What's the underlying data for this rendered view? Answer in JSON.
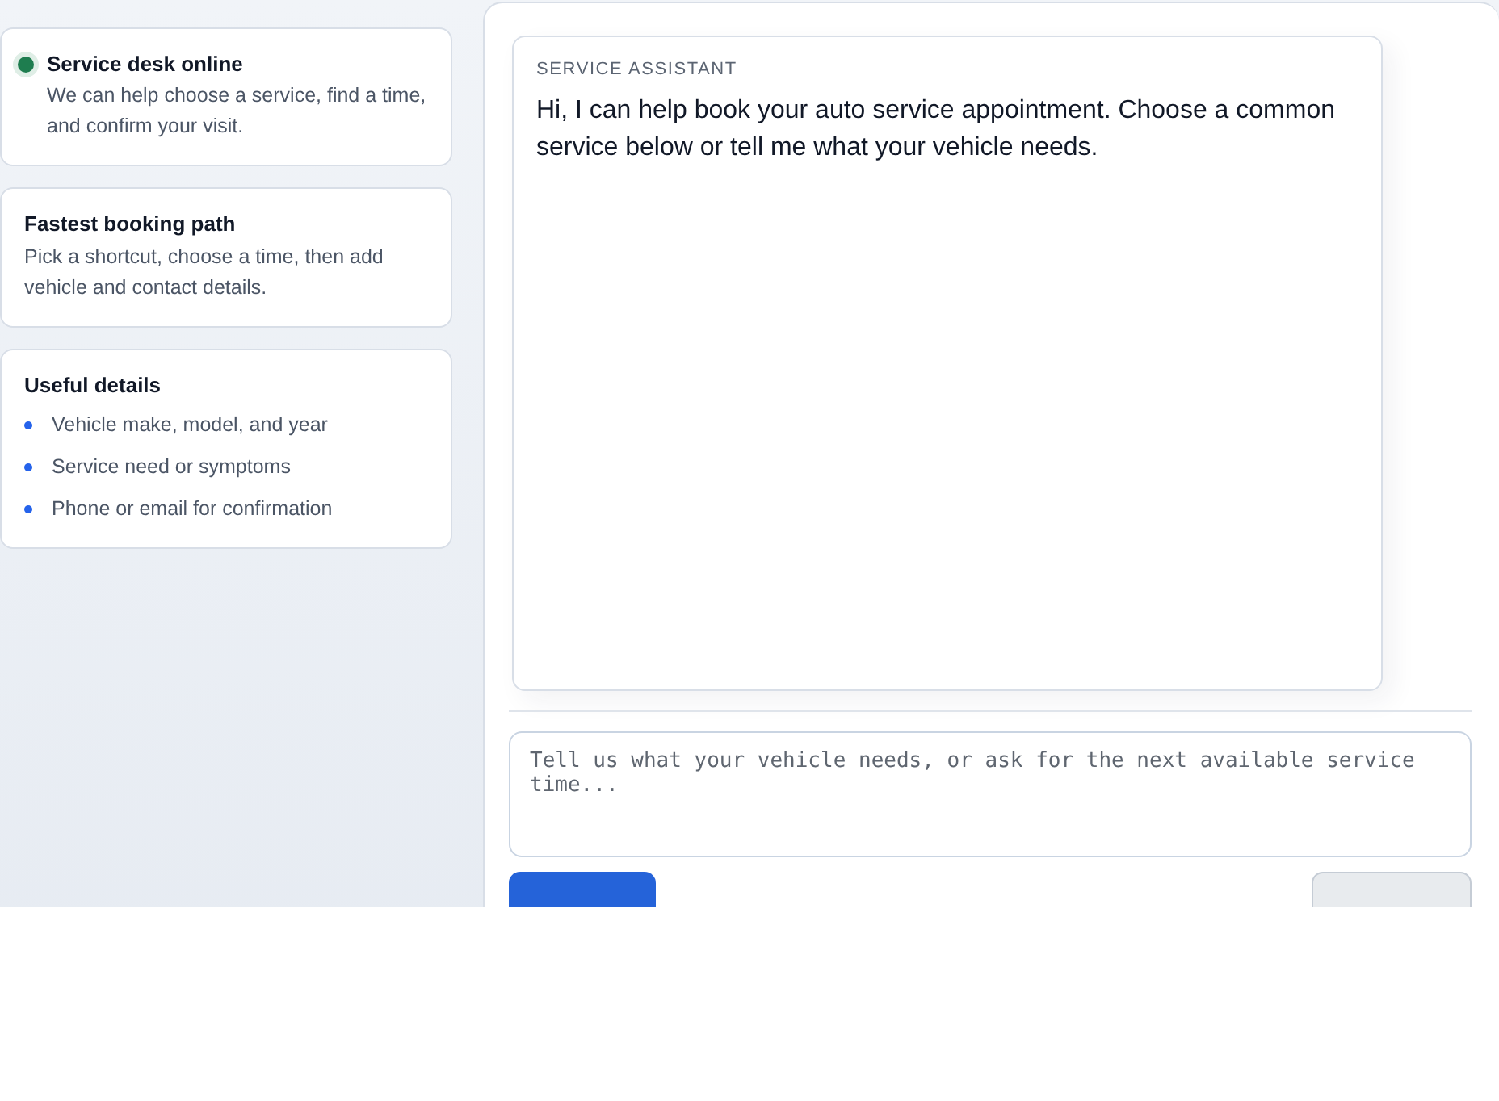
{
  "status": {
    "online": true,
    "title": "Service desk online",
    "text": "We can help choose a service, find a time, and confirm your visit."
  },
  "path_card": {
    "title": "Fastest booking path",
    "text": "Pick a shortcut, choose a time, then add vehicle and contact details."
  },
  "details_card": {
    "title": "Useful details",
    "items": [
      "Vehicle make, model, and year",
      "Service need or symptoms",
      "Phone or email for confirmation"
    ]
  },
  "message": {
    "sender": "SERVICE ASSISTANT",
    "text": "Hi, I can help book your auto service appointment. Choose a common service below or tell me what your vehicle needs."
  },
  "composer": {
    "placeholder": "Tell us what your vehicle needs, or ask for the next available service time..."
  }
}
